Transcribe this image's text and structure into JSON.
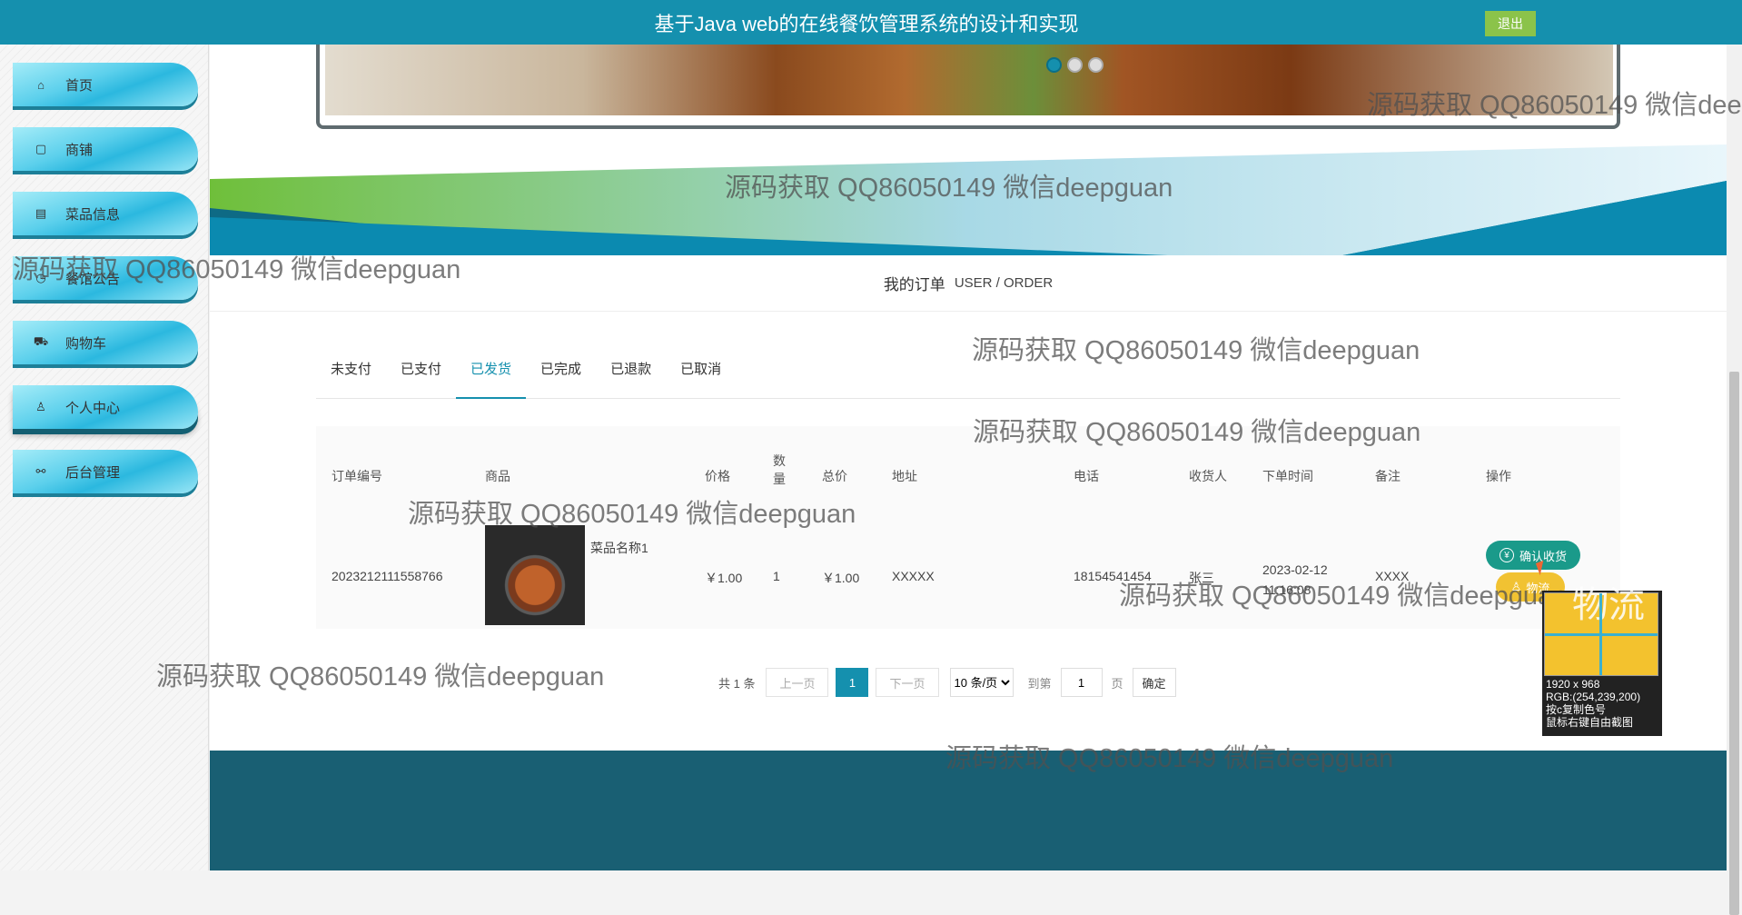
{
  "header": {
    "title": "基于Java web的在线餐饮管理系统的设计和实现",
    "exit_label": "退出"
  },
  "sidebar": {
    "items": [
      {
        "label": "首页",
        "icon": "home-icon"
      },
      {
        "label": "商铺",
        "icon": "note-icon"
      },
      {
        "label": "菜品信息",
        "icon": "clipboard-icon"
      },
      {
        "label": "餐馆公告",
        "icon": "clock-icon"
      },
      {
        "label": "购物车",
        "icon": "cart-icon"
      },
      {
        "label": "个人中心",
        "icon": "user-icon"
      },
      {
        "label": "后台管理",
        "icon": "link-icon"
      }
    ],
    "active_index": 5
  },
  "breadcrumb": {
    "cn": "我的订单",
    "en": "USER / ORDER"
  },
  "tabs": [
    "未支付",
    "已支付",
    "已发货",
    "已完成",
    "已退款",
    "已取消"
  ],
  "active_tab": 2,
  "table": {
    "headers": [
      "订单编号",
      "商品",
      "价格",
      "数\n量",
      "总价",
      "地址",
      "电话",
      "收货人",
      "下单时间",
      "备注",
      "操作"
    ],
    "rows": [
      {
        "order_no": "2023212111558766",
        "product_name": "菜品名称1",
        "price": "￥1.00",
        "qty": "1",
        "total": "￥1.00",
        "address": "XXXXX",
        "phone": "18154541454",
        "receiver": "张三",
        "time": "2023-02-12\n11:16:08",
        "remark": "XXXX",
        "confirm_label": "确认收货",
        "logistics_label": "物流"
      }
    ]
  },
  "pager": {
    "total": "共 1 条",
    "prev": "上一页",
    "current": "1",
    "next": "下一页",
    "page_size": "10 条/页",
    "goto_label": "到第",
    "goto_value": "1",
    "page_unit": "页",
    "confirm": "确定"
  },
  "picker": {
    "size": "1920 x 968",
    "rgb": "RGB:(254,239,200)",
    "tip1": "按c复制色号",
    "tip2": "鼠标右键自由截图",
    "zoom_text": "物流"
  },
  "watermark": "源码获取 QQ86050149 微信deepguan",
  "colors": {
    "primary": "#1590ae",
    "footer": "#195f73",
    "confirm": "#1a9a8a",
    "logistics": "#f1c232"
  }
}
